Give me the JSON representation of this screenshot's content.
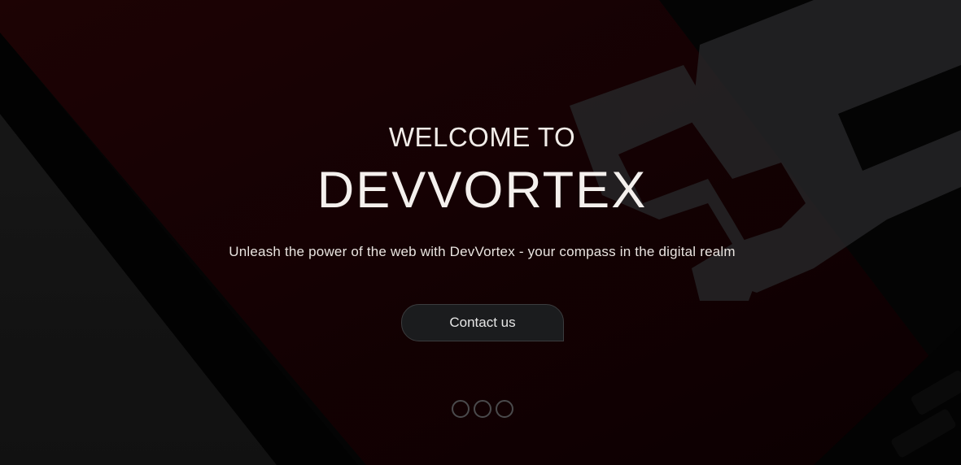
{
  "hero": {
    "welcome": "WELCOME TO",
    "brand": "DEVVORTEX",
    "tagline": "Unleash the power of the web with DevVortex - your compass in the digital realm",
    "cta_label": "Contact us",
    "background_text": "55"
  },
  "carousel": {
    "indicators": [
      {
        "label": "Slide 1"
      },
      {
        "label": "Slide 2"
      },
      {
        "label": "Slide 3"
      }
    ]
  },
  "colors": {
    "background": "#050505",
    "tablet_red": "#2a0306",
    "text": "#f1ece8",
    "button_bg": "#1b1c1e",
    "indicator_border": "#4a4a4c"
  }
}
